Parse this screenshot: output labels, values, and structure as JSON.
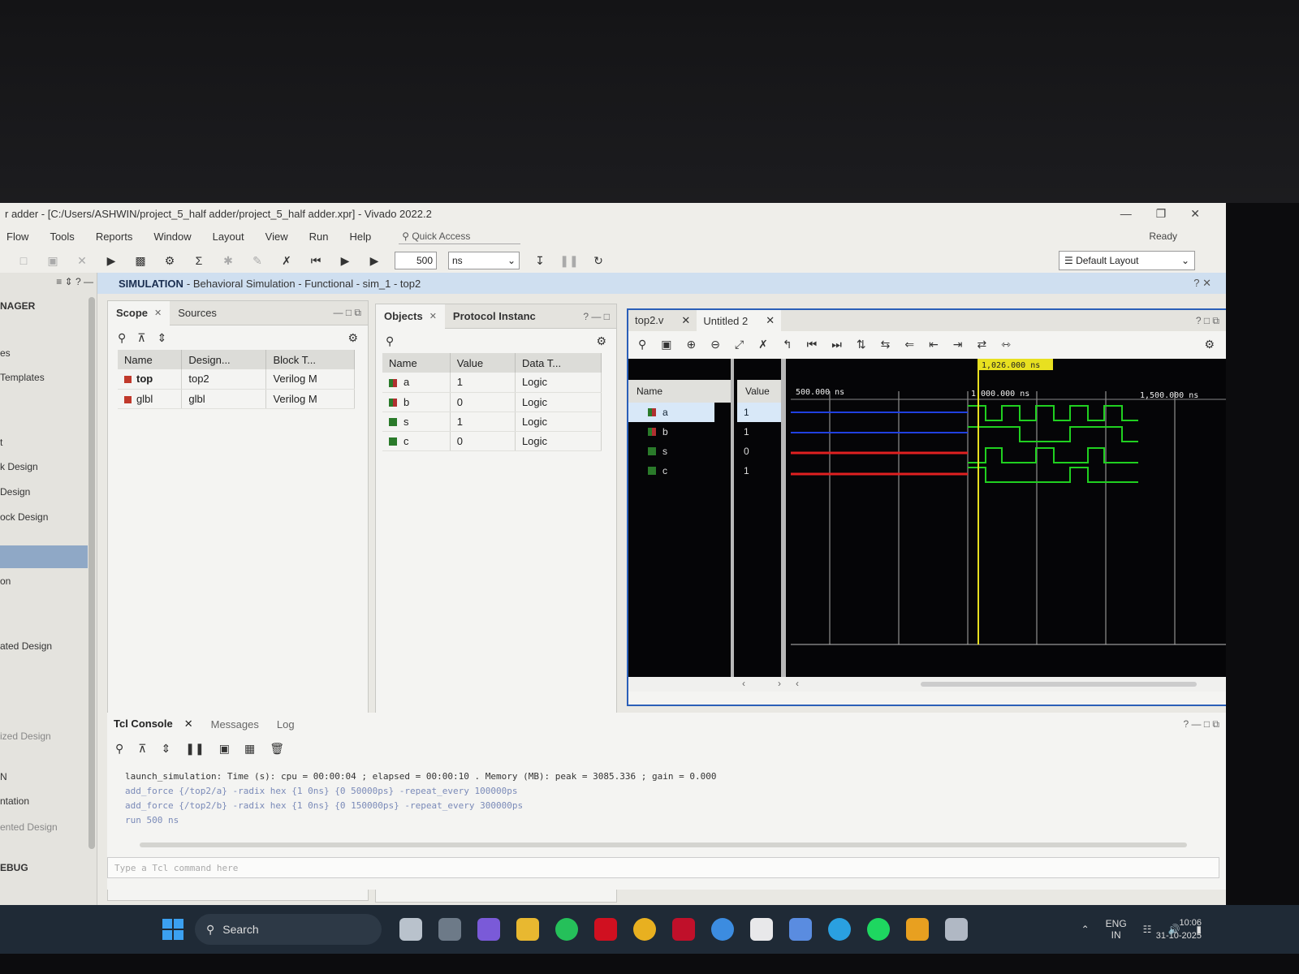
{
  "window": {
    "title": "r adder - [C:/Users/ASHWIN/project_5_half adder/project_5_half adder.xpr] - Vivado 2022.2",
    "status": "Ready"
  },
  "menu": [
    "Flow",
    "Tools",
    "Reports",
    "Window",
    "Layout",
    "View",
    "Run",
    "Help"
  ],
  "quick_access": "Quick Access",
  "toolbar": {
    "run_time": "500",
    "time_unit": "ns",
    "layout": "Default Layout"
  },
  "left_nav": {
    "header": "NAGER",
    "items": [
      "es",
      "Templates",
      "t",
      "k Design",
      "Design",
      "ock Design",
      "on",
      "ated Design",
      "ized Design",
      "N",
      "ntation",
      "ented Design",
      "EBUG"
    ]
  },
  "sim_header": {
    "label": "SIMULATION",
    "detail": "- Behavioral Simulation - Functional - sim_1 - top2"
  },
  "scope_panel": {
    "tabs": [
      "Scope",
      "Sources"
    ],
    "columns": [
      "Name",
      "Design...",
      "Block T..."
    ],
    "rows": [
      {
        "name": "top",
        "design": "top2",
        "block": "Verilog M"
      },
      {
        "name": "glbl",
        "design": "glbl",
        "block": "Verilog M"
      }
    ]
  },
  "objects_panel": {
    "tabs": [
      "Objects",
      "Protocol Instanc"
    ],
    "columns": [
      "Name",
      "Value",
      "Data T..."
    ],
    "rows": [
      {
        "name": "a",
        "value": "1",
        "type": "Logic"
      },
      {
        "name": "b",
        "value": "0",
        "type": "Logic"
      },
      {
        "name": "s",
        "value": "1",
        "type": "Logic"
      },
      {
        "name": "c",
        "value": "0",
        "type": "Logic"
      }
    ]
  },
  "wave": {
    "tabs": [
      "top2.v",
      "Untitled 2"
    ],
    "name_header": "Name",
    "value_header": "Value",
    "cursor_label": "1,026.000 ns",
    "ticks": [
      "500.000 ns",
      "1,000.000 ns",
      "1,500.000 ns"
    ],
    "signals": [
      {
        "name": "a",
        "value": "1"
      },
      {
        "name": "b",
        "value": "1"
      },
      {
        "name": "s",
        "value": "0"
      },
      {
        "name": "c",
        "value": "1"
      }
    ],
    "colors": {
      "initial_a_b": "#2040e0",
      "initial_s_c": "#e02020",
      "active": "#20d020",
      "cursor": "#e8e020"
    }
  },
  "console": {
    "tabs": [
      "Tcl Console",
      "Messages",
      "Log"
    ],
    "lines": [
      "launch_simulation: Time (s): cpu = 00:00:04 ; elapsed = 00:00:10 . Memory (MB): peak = 3085.336 ; gain = 0.000",
      "add_force {/top2/a} -radix hex {1 0ns} {0 50000ps} -repeat_every 100000ps",
      "add_force {/top2/b} -radix hex {1 0ns} {0 150000ps} -repeat_every 300000ps",
      "run 500 ns"
    ],
    "placeholder": "Type a Tcl command here"
  },
  "taskbar": {
    "search": "Search",
    "lang": "ENG",
    "region": "IN",
    "time": "10:06",
    "date": "31-10-2025"
  }
}
